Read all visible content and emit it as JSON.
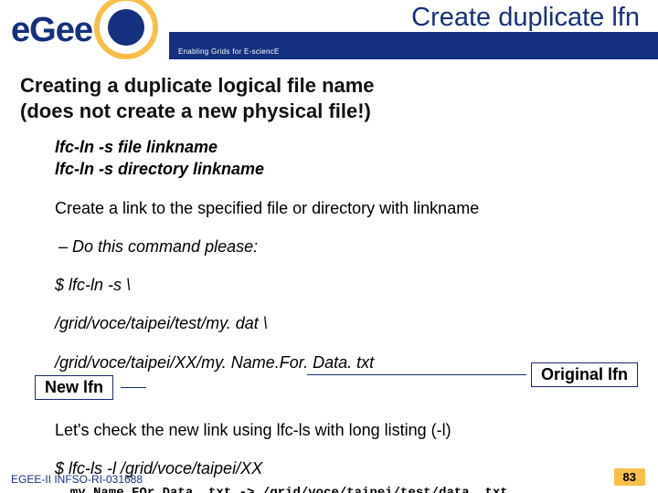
{
  "header": {
    "title": "Create  duplicate lfn",
    "tagline": "Enabling Grids for E-sciencE",
    "logo_text": "eGee"
  },
  "main": {
    "heading_l1": "Creating a duplicate logical file name",
    "heading_l2": "(does not create a new physical file!)",
    "cmd1": "lfc-ln -s file linkname",
    "cmd2": "lfc-ln -s directory linkname",
    "desc": "Create a link to the specified file or directory with linkname",
    "do_line": "–  Do this command please:",
    "ex1": "$ lfc-ln -s \\",
    "ex2": "/grid/voce/taipei/test/my. dat \\",
    "ex3": "/grid/voce/taipei/XX/my. Name.For. Data. txt",
    "box_left": "New lfn",
    "box_right": "Original lfn",
    "check": "Let's check the new link using lfc-ls with long listing (-l)",
    "ls_cmd": "$ lfc-ls -l /grid/voce/taipei/XX",
    "output": "… my.Name.FOr.Data. txt -> /grid/voce/taipei/test/data. txt"
  },
  "footer": {
    "left": "EGEE-II INFSO-RI-031688",
    "page": "83"
  }
}
